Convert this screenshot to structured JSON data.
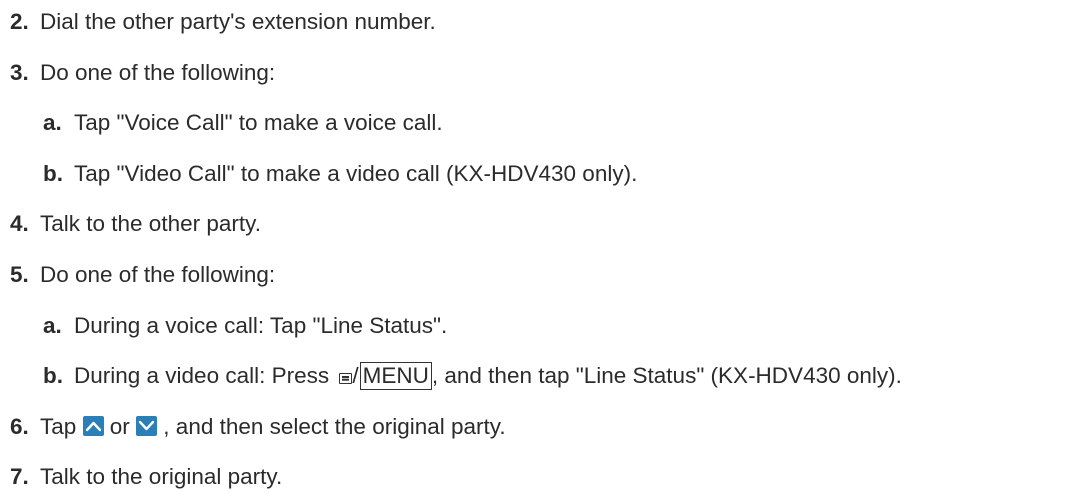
{
  "steps": [
    {
      "num": "2.",
      "text": "Dial the other party's extension number."
    },
    {
      "num": "3.",
      "text": "Do one of the following:"
    },
    {
      "num": "a.",
      "text": "Tap \"Voice Call\" to make a voice call."
    },
    {
      "num": "b.",
      "text": "Tap \"Video Call\" to make a video call (KX-HDV430 only)."
    },
    {
      "num": "4.",
      "text": "Talk to the other party."
    },
    {
      "num": "5.",
      "text": "Do one of the following:"
    },
    {
      "num": "a.",
      "text": "During a voice call: Tap \"Line Status\"."
    },
    {
      "num": "b.",
      "text_before": "During a video call: Press ",
      "sep": "/",
      "key": "MENU",
      "text_after": ", and then tap \"Line Status\" (KX-HDV430 only)."
    },
    {
      "num": "6.",
      "text_before": "Tap ",
      "text_mid": " or ",
      "text_after": " , and then select the original party."
    },
    {
      "num": "7.",
      "text": "Talk to the original party."
    }
  ],
  "icons": {
    "menu": "menu-icon",
    "up": "chevron-up-icon",
    "down": "chevron-down-icon"
  },
  "colors": {
    "text": "#2b2b2b",
    "button": "#2a7fb8"
  }
}
